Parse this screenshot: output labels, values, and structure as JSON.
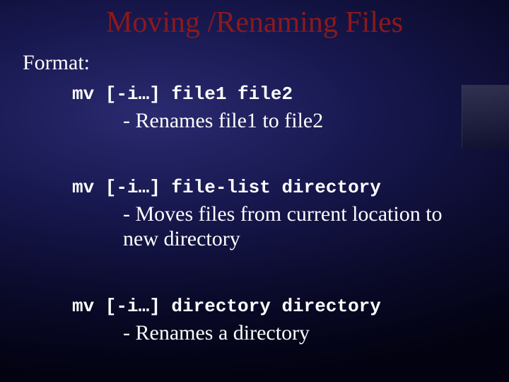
{
  "title": "Moving /Renaming Files",
  "format_label": "Format:",
  "items": [
    {
      "cmd": "mv [-i…] file1 file2",
      "desc": "- Renames file1 to file2"
    },
    {
      "cmd": "mv [-i…] file-list directory",
      "desc": "- Moves files from current location to new directory"
    },
    {
      "cmd": "mv [-i…] directory directory",
      "desc": "- Renames a directory"
    }
  ]
}
